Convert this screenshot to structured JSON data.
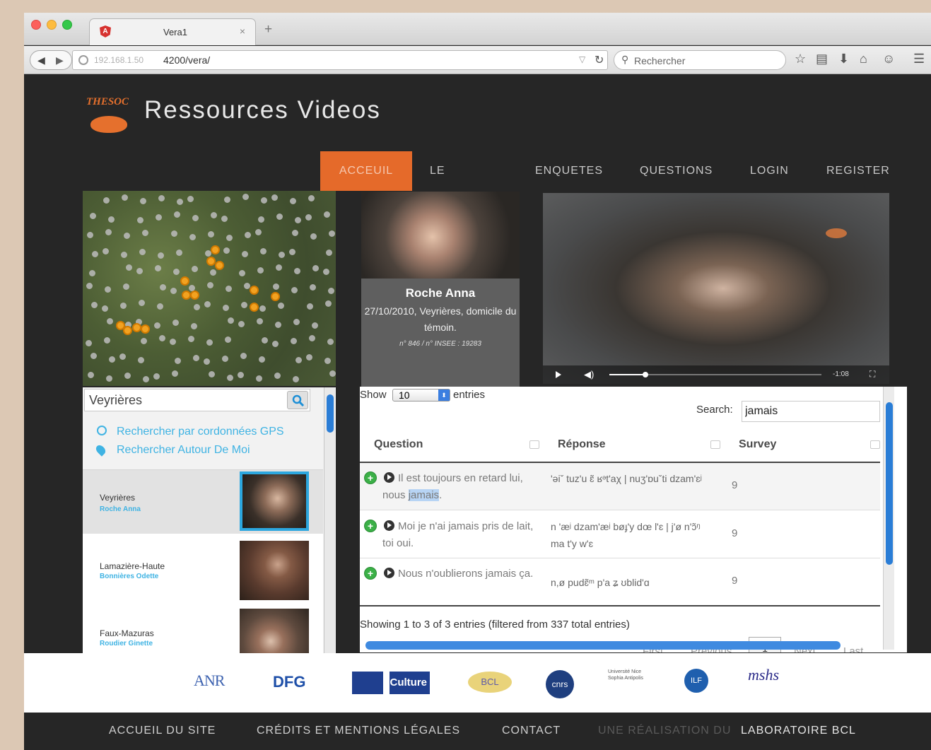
{
  "browser": {
    "tab_title": "Vera1",
    "tab_close": "×",
    "new_tab": "+",
    "url_host": "192.168.1.50",
    "url_path": "4200/vera/",
    "search_placeholder": "Rechercher"
  },
  "site": {
    "logo_text": "THESOC",
    "title": "Ressources Videos"
  },
  "nav": {
    "items": [
      "ACCEUIL",
      "LE PROJET",
      "ENQUETES",
      "QUESTIONS",
      "LOGIN",
      "REGISTER"
    ],
    "active": "ACCEUIL"
  },
  "locations": {
    "search_value": "Veyrières",
    "gps_label": "Rechercher par cordonnées GPS",
    "near_label": "Rechercher Autour De Moi",
    "items": [
      {
        "place": "Veyrières",
        "person": "Roche Anna"
      },
      {
        "place": "Lamazière-Haute",
        "person": "Bonnières Odette"
      },
      {
        "place": "Faux-Mazuras",
        "person": "Roudier Ginette"
      }
    ]
  },
  "person": {
    "name": "Roche Anna",
    "meta": "27/10/2010, Veyrières, domicile du témoin.",
    "insee": "n° 846 / n° INSEE : 19283"
  },
  "video": {
    "time_remaining": "-1:08",
    "progress": 0.17
  },
  "table": {
    "show_label": "Show",
    "show_value": "10",
    "entries_label": "entries",
    "search_label": "Search:",
    "search_value": "jamais",
    "columns": [
      "Question",
      "Réponse",
      "Survey"
    ],
    "rows": [
      {
        "q_before": "Il est toujours en retard lui, nous ",
        "q_hl": "jamais",
        "q_after": ".",
        "r": "'əiˇ tuz'u ɛ̃ ʁᵊt'aχ | nuʒ'ɒuˇti dzam'ɛʲ",
        "s": "9"
      },
      {
        "q_before": "Moi je n'ai jamais pris de lait, toi oui.",
        "q_hl": "",
        "q_after": "",
        "r": "n 'æʲ dzam'æʲ bøɟ'y dœ l'ɛ | j'ø n'ɔ̃ᵑ ma t'y w'ɛ",
        "s": "9"
      },
      {
        "q_before": "Nous n'oublierons jamais ça.",
        "q_hl": "",
        "q_after": "",
        "r": "n,ø pudɛ̃ᵐ p'a ʑ ʊblid'ɑ",
        "s": "9"
      }
    ],
    "info": "Showing 1 to 3 of 3 entries (filtered from 337 total entries)",
    "pagination": {
      "first": "First",
      "previous": "Previous",
      "current": "1",
      "next": "Next",
      "last": "Last"
    }
  },
  "sponsors": [
    "ANR",
    "DFG",
    "Culture",
    "BCL",
    "cnrs",
    "Université Nice Sophia Antipolis",
    "ILF",
    "mshs"
  ],
  "footer": {
    "links": [
      "ACCUEIL DU SITE",
      "CRÉDITS ET MENTIONS LÉGALES",
      "CONTACT"
    ],
    "realisation": "UNE RÉALISATION DU",
    "lab": "LABORATOIRE BCL"
  },
  "colors": {
    "accent": "#e56a2a",
    "link": "#3fb3e3",
    "marker": "#f2a221"
  }
}
